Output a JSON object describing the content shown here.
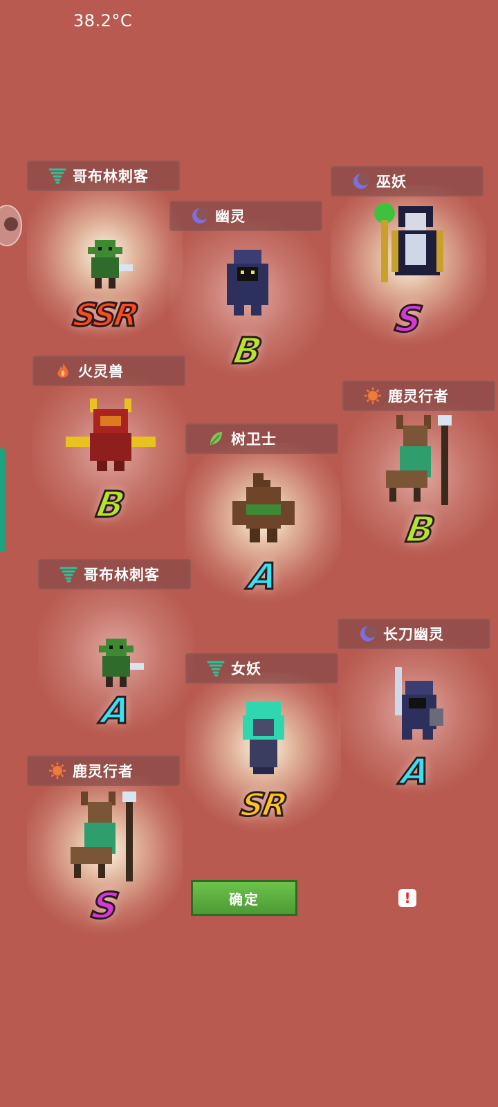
{
  "status": {
    "temperature": "38.2°C"
  },
  "cards": [
    {
      "name": "哥布林刺客",
      "element": "wind-icon",
      "grade": "SSR"
    },
    {
      "name": "幽灵",
      "element": "moon-icon",
      "grade": "B"
    },
    {
      "name": "巫妖",
      "element": "moon-icon",
      "grade": "S"
    },
    {
      "name": "火灵兽",
      "element": "fire-icon",
      "grade": "B"
    },
    {
      "name": "鹿灵行者",
      "element": "sun-icon",
      "grade": "B"
    },
    {
      "name": "树卫士",
      "element": "leaf-icon",
      "grade": "A"
    },
    {
      "name": "哥布林刺客",
      "element": "wind-icon",
      "grade": "A"
    },
    {
      "name": "长刀幽灵",
      "element": "moon-icon",
      "grade": "A"
    },
    {
      "name": "女妖",
      "element": "wind-icon",
      "grade": "SR"
    },
    {
      "name": "鹿灵行者",
      "element": "sun-icon",
      "grade": "S"
    }
  ],
  "actions": {
    "confirm_label": "确定",
    "alert_label": "!"
  },
  "colors": {
    "background": "#b85a4f",
    "grade_SSR": "#ff4a1e",
    "grade_S": "#d53ad9",
    "grade_SR": "#ffc51d",
    "grade_A": "#38e1f5",
    "grade_B": "#b4e42e",
    "confirm": "#5aaf3f"
  }
}
